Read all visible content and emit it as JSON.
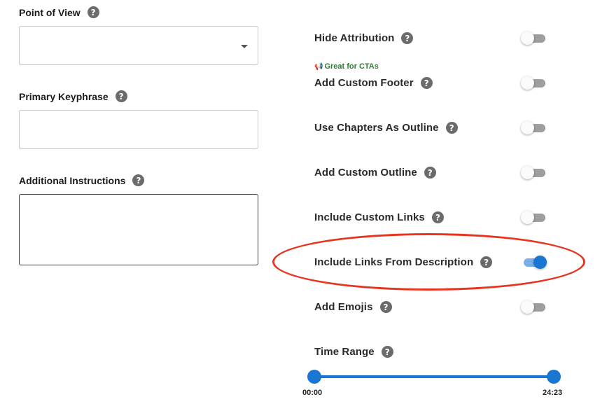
{
  "left_form": {
    "point_of_view": {
      "label": "Point of View",
      "value": ""
    },
    "primary_keyphrase": {
      "label": "Primary Keyphrase",
      "value": ""
    },
    "additional_instructions": {
      "label": "Additional Instructions",
      "value": ""
    }
  },
  "help_glyph": "?",
  "options": {
    "hide_attribution": {
      "label": "Hide Attribution",
      "enabled": false
    },
    "cta_badge": {
      "icon": "megaphone-icon",
      "text": "Great for CTAs"
    },
    "add_custom_footer": {
      "label": "Add Custom Footer",
      "enabled": false
    },
    "use_chapters_as_outline": {
      "label": "Use Chapters As Outline",
      "enabled": false
    },
    "add_custom_outline": {
      "label": "Add Custom Outline",
      "enabled": false
    },
    "include_custom_links": {
      "label": "Include Custom Links",
      "enabled": false
    },
    "include_links_from_description": {
      "label": "Include Links From Description",
      "enabled": true
    },
    "add_emojis": {
      "label": "Add Emojis",
      "enabled": false
    }
  },
  "time_range": {
    "label": "Time Range",
    "start": "00:00",
    "end": "24:23"
  },
  "colors": {
    "accent": "#1976d2",
    "badge_green": "#2e7d32",
    "highlight_red": "#e8331f"
  }
}
